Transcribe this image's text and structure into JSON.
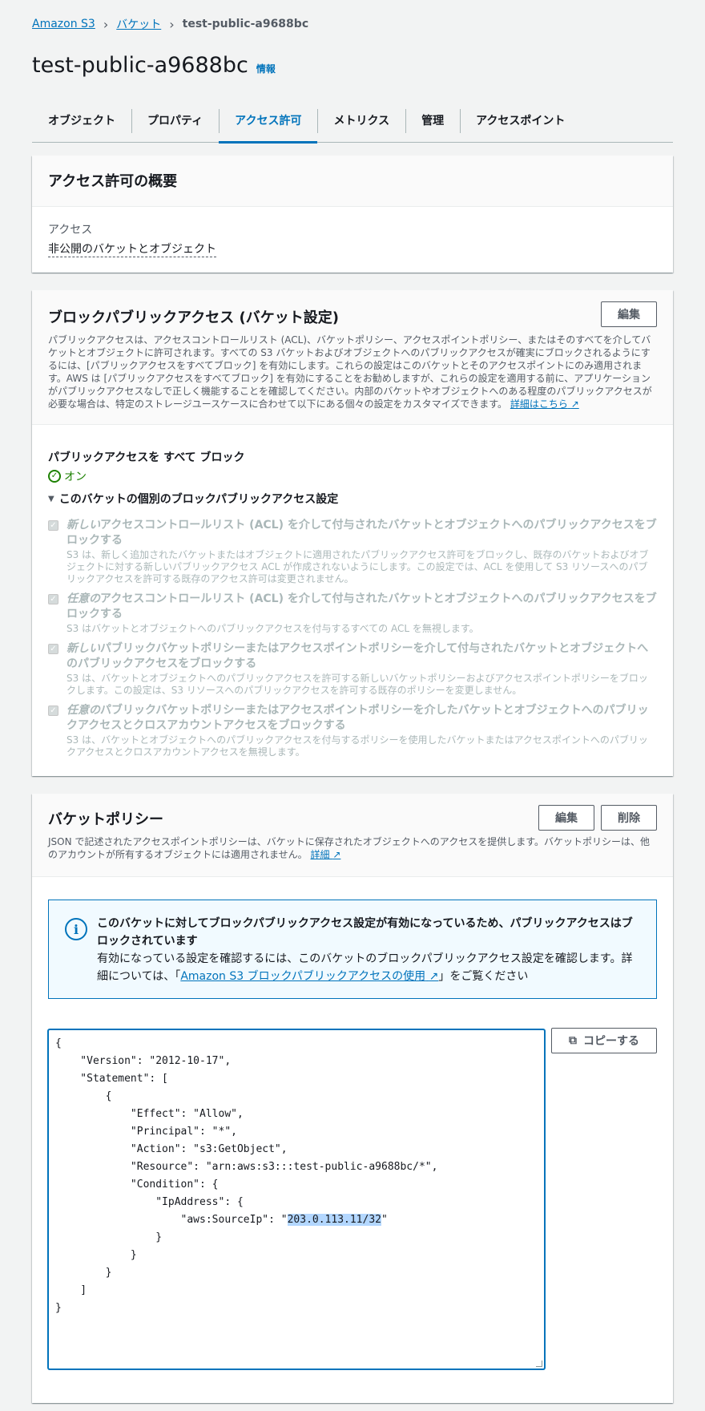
{
  "breadcrumb": {
    "items": [
      "Amazon S3",
      "バケット"
    ],
    "current": "test-public-a9688bc"
  },
  "page": {
    "title": "test-public-a9688bc",
    "info_link": "情報"
  },
  "tabs": [
    {
      "label": "オブジェクト",
      "active": false
    },
    {
      "label": "プロパティ",
      "active": false
    },
    {
      "label": "アクセス許可",
      "active": true
    },
    {
      "label": "メトリクス",
      "active": false
    },
    {
      "label": "管理",
      "active": false
    },
    {
      "label": "アクセスポイント",
      "active": false
    }
  ],
  "summary": {
    "title": "アクセス許可の概要",
    "access_label": "アクセス",
    "access_value": "非公開のバケットとオブジェクト"
  },
  "bpa": {
    "title": "ブロックパブリックアクセス (バケット設定)",
    "edit_label": "編集",
    "description": "パブリックアクセスは、アクセスコントロールリスト (ACL)、バケットポリシー、アクセスポイントポリシー、またはそのすべてを介してバケットとオブジェクトに許可されます。すべての S3 バケットおよびオブジェクトへのパブリックアクセスが確実にブロックされるようにするには、[パブリックアクセスをすべてブロック] を有効にします。これらの設定はこのバケットとそのアクセスポイントにのみ適用されます。AWS は [パブリックアクセスをすべてブロック] を有効にすることをお勧めしますが、これらの設定を適用する前に、アプリケーションがパブリックアクセスなしで正しく機能することを確認してください。内部のバケットやオブジェクトへのある程度のパブリックアクセスが必要な場合は、特定のストレージユースケースに合わせて以下にある個々の設定をカスタマイズできます。",
    "learn_more": "詳細はこちら",
    "block_all_title": "パブリックアクセスを すべて ブロック",
    "block_all_status": "オン",
    "expander_label": "このバケットの個別のブロックパブリックアクセス設定",
    "settings": [
      {
        "emph": "新しい",
        "title": "アクセスコントロールリスト (ACL) を介して付与されたバケットとオブジェクトへのパブリックアクセスをブロックする",
        "desc": "S3 は、新しく追加されたバケットまたはオブジェクトに適用されたパブリックアクセス許可をブロックし、既存のバケットおよびオブジェクトに対する新しいパブリックアクセス ACL が作成されないようにします。この設定では、ACL を使用して S3 リソースへのパブリックアクセスを許可する既存のアクセス許可は変更されません。"
      },
      {
        "emph": "任意の",
        "title": "アクセスコントロールリスト (ACL) を介して付与されたバケットとオブジェクトへのパブリックアクセスをブロックする",
        "desc": "S3 はバケットとオブジェクトへのパブリックアクセスを付与するすべての ACL を無視します。"
      },
      {
        "emph": "新しい",
        "title": "パブリックバケットポリシーまたはアクセスポイントポリシーを介して付与されたバケットとオブジェクトへのパブリックアクセスをブロックする",
        "desc": "S3 は、バケットとオブジェクトへのパブリックアクセスを許可する新しいバケットポリシーおよびアクセスポイントポリシーをブロックします。この設定は、S3 リソースへのパブリックアクセスを許可する既存のポリシーを変更しません。"
      },
      {
        "emph": "任意の",
        "title": "パブリックバケットポリシーまたはアクセスポイントポリシーを介したバケットとオブジェクトへのパブリックアクセスとクロスアカウントアクセスをブロックする",
        "desc": "S3 は、バケットとオブジェクトへのパブリックアクセスを付与するポリシーを使用したバケットまたはアクセスポイントへのパブリックアクセスとクロスアカウントアクセスを無視します。"
      }
    ]
  },
  "policy": {
    "title": "バケットポリシー",
    "edit_label": "編集",
    "delete_label": "削除",
    "description": "JSON で記述されたアクセスポイントポリシーは、バケットに保存されたオブジェクトへのアクセスを提供します。バケットポリシーは、他のアカウントが所有するオブジェクトには適用されません。",
    "learn_more": "詳細",
    "alert_title": "このバケットに対してブロックパブリックアクセス設定が有効になっているため、パブリックアクセスはブロックされています",
    "alert_body_pre": "有効になっている設定を確認するには、このバケットのブロックパブリックアクセス設定を確認します。詳細については、「",
    "alert_link": "Amazon S3 ブロックパブリックアクセスの使用",
    "alert_body_post": "」をご覧ください",
    "copy_label": "コピーする",
    "json_before": "{\n    \"Version\": \"2012-10-17\",\n    \"Statement\": [\n        {\n            \"Effect\": \"Allow\",\n            \"Principal\": \"*\",\n            \"Action\": \"s3:GetObject\",\n            \"Resource\": \"arn:aws:s3:::test-public-a9688bc/*\",\n            \"Condition\": {\n                \"IpAddress\": {\n                    \"aws:SourceIp\": \"",
    "json_selected": "203.0.113.11/32",
    "json_after": "\"\n                }\n            }\n        }\n    ]\n}"
  },
  "colors": {
    "accent": "#0073bb",
    "success": "#1d8102",
    "disabled_text": "#aab7b8"
  }
}
